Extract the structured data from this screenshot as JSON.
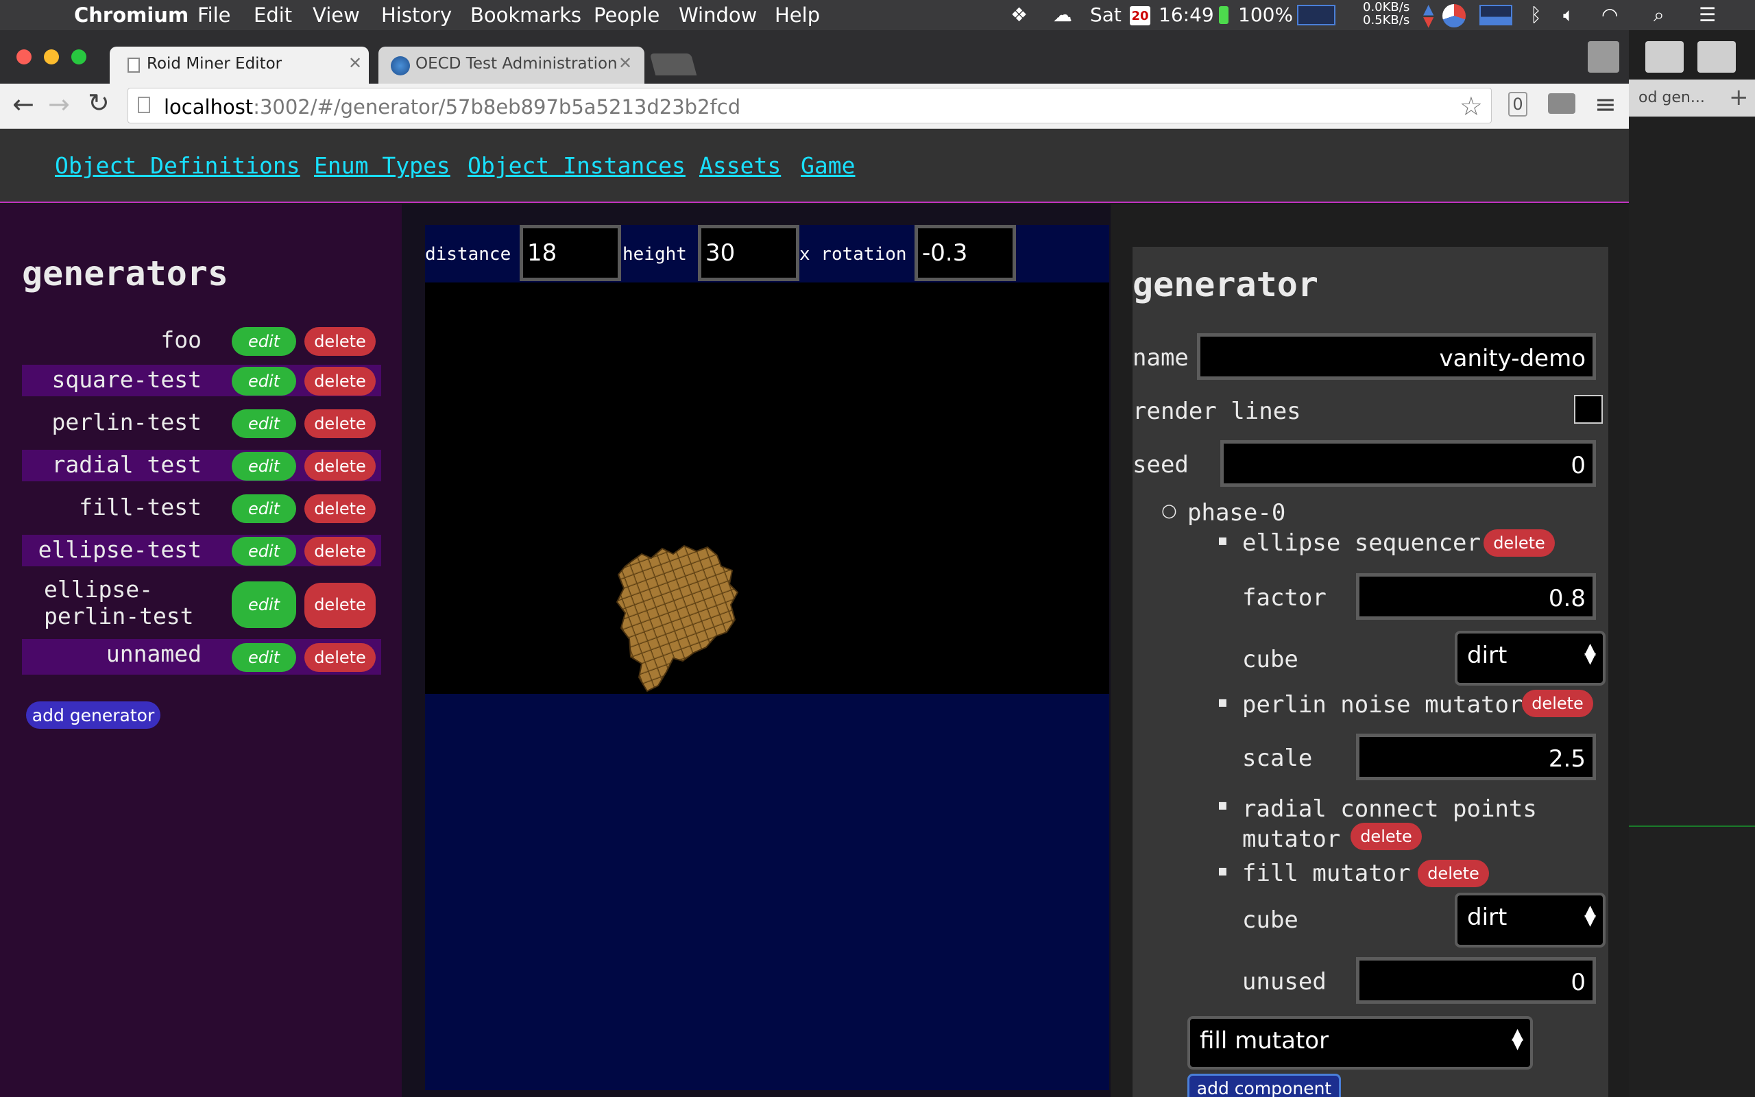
{
  "os_menubar": {
    "app_name": "Chromium",
    "menus": [
      "File",
      "Edit",
      "View",
      "History",
      "Bookmarks",
      "People",
      "Window",
      "Help"
    ],
    "status": {
      "day": "Sat",
      "calendar_date": "20",
      "time": "16:49",
      "battery": "100%",
      "net_up": "0.0KB/s",
      "net_down": "0.5KB/s"
    }
  },
  "browser": {
    "tabs": [
      {
        "title": "Roid Miner Editor",
        "active": true
      },
      {
        "title": "OECD Test Administration",
        "active": false
      }
    ],
    "url_host": "localhost",
    "url_rest": ":3002/#/generator/57b8eb897b5a5213d23b2fcd",
    "extension_badge": "0",
    "ghost_tab_title": "od gen..."
  },
  "nav": {
    "links": [
      "Object Definitions",
      "Enum Types",
      "Object Instances",
      "Assets",
      "Game"
    ]
  },
  "sidebar": {
    "title": "generators",
    "edit_label": "edit",
    "delete_label": "delete",
    "items": [
      {
        "name": "foo"
      },
      {
        "name": "square-test"
      },
      {
        "name": "perlin-test"
      },
      {
        "name": "radial test"
      },
      {
        "name": "fill-test"
      },
      {
        "name": "ellipse-test"
      },
      {
        "name": "ellipse-perlin-test",
        "line1": "ellipse-",
        "line2": "perlin-test"
      },
      {
        "name": "unnamed"
      }
    ],
    "add_label": "add generator"
  },
  "viewport": {
    "distance_label": "distance",
    "distance_value": "18",
    "height_label": "height",
    "height_value": "30",
    "xrot_label": "x rotation",
    "xrot_value": "-0.3"
  },
  "editor": {
    "title": "generator",
    "name_label": "name",
    "name_value": "vanity-demo",
    "render_lines_label": "render lines",
    "render_lines_checked": false,
    "seed_label": "seed",
    "seed_value": "0",
    "phase_label": "phase-0",
    "delete_label": "delete",
    "components": {
      "ellipse": {
        "label": "ellipse sequencer",
        "factor_label": "factor",
        "factor_value": "0.8",
        "cube_label": "cube",
        "cube_value": "dirt"
      },
      "perlin": {
        "label": "perlin noise mutator",
        "scale_label": "scale",
        "scale_value": "2.5"
      },
      "radial": {
        "label_line1": "radial connect points",
        "label_line2": "mutator"
      },
      "fill": {
        "label": "fill mutator",
        "cube_label": "cube",
        "cube_value": "dirt",
        "unused_label": "unused",
        "unused_value": "0"
      }
    },
    "component_select_value": "fill mutator",
    "add_component_label": "add component"
  },
  "colors": {
    "nav_link": "#19e0ff",
    "edit_green": "#2db53a",
    "delete_red": "#c7353c",
    "sidebar_bg": "#2a0a30",
    "sidebar_alt_row": "#4a0868",
    "viewport_blue": "#000844",
    "accent_magenta": "#c233c2"
  }
}
